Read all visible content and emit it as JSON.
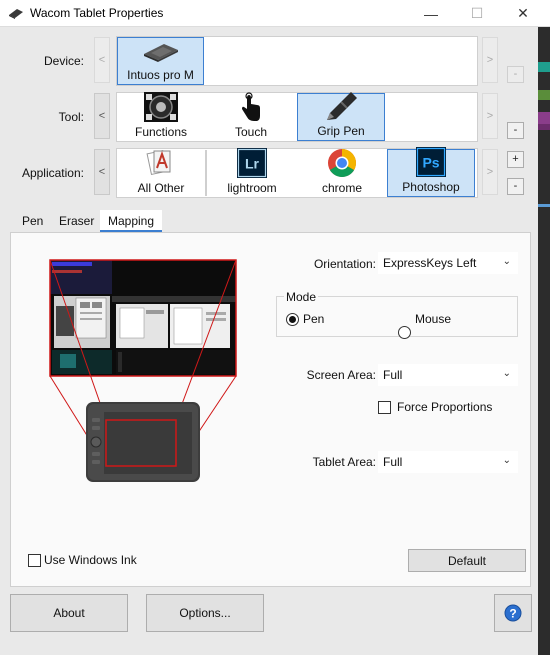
{
  "window": {
    "title": "Wacom Tablet Properties"
  },
  "controls": {
    "minimize": "—",
    "maximize": "☐",
    "close": "✕"
  },
  "device": {
    "label": "Device:",
    "items": [
      {
        "name": "Intuos pro M",
        "selected": true
      }
    ],
    "remove": "-"
  },
  "tool": {
    "label": "Tool:",
    "items": [
      {
        "name": "Functions",
        "selected": false
      },
      {
        "name": "Touch",
        "selected": false
      },
      {
        "name": "Grip Pen",
        "selected": true
      }
    ],
    "remove": "-"
  },
  "application": {
    "label": "Application:",
    "items": [
      {
        "name": "All Other",
        "selected": false
      },
      {
        "name": "lightroom",
        "selected": false,
        "icon_text": "Lr"
      },
      {
        "name": "chrome",
        "selected": false
      },
      {
        "name": "Photoshop",
        "selected": true,
        "icon_text": "Ps"
      }
    ],
    "add": "+",
    "remove": "-"
  },
  "scroll": {
    "left": "<",
    "right": ">"
  },
  "tabs": [
    {
      "label": "Pen",
      "active": false
    },
    {
      "label": "Eraser",
      "active": false
    },
    {
      "label": "Mapping",
      "active": true
    }
  ],
  "mapping": {
    "orientation_label": "Orientation:",
    "orientation_value": "ExpressKeys Left",
    "mode_label": "Mode",
    "mode_pen": "Pen",
    "mode_mouse": "Mouse",
    "selected_mode": "Pen",
    "screen_area_label": "Screen Area:",
    "screen_area_value": "Full",
    "force_proportions": "Force Proportions",
    "tablet_area_label": "Tablet Area:",
    "tablet_area_value": "Full",
    "use_windows_ink": "Use Windows Ink",
    "default_button": "Default"
  },
  "footer": {
    "about": "About",
    "options": "Options...",
    "help": "?"
  },
  "colors": {
    "selection": "#cde3f7",
    "selection_border": "#3c7fd1",
    "mapping_red": "#d01818",
    "photoshop": "#001e36",
    "photoshop_accent": "#31a8ff",
    "lightroom": "#001e36",
    "lightroom_accent": "#add5ec",
    "help_blue": "#2b6fcf"
  }
}
